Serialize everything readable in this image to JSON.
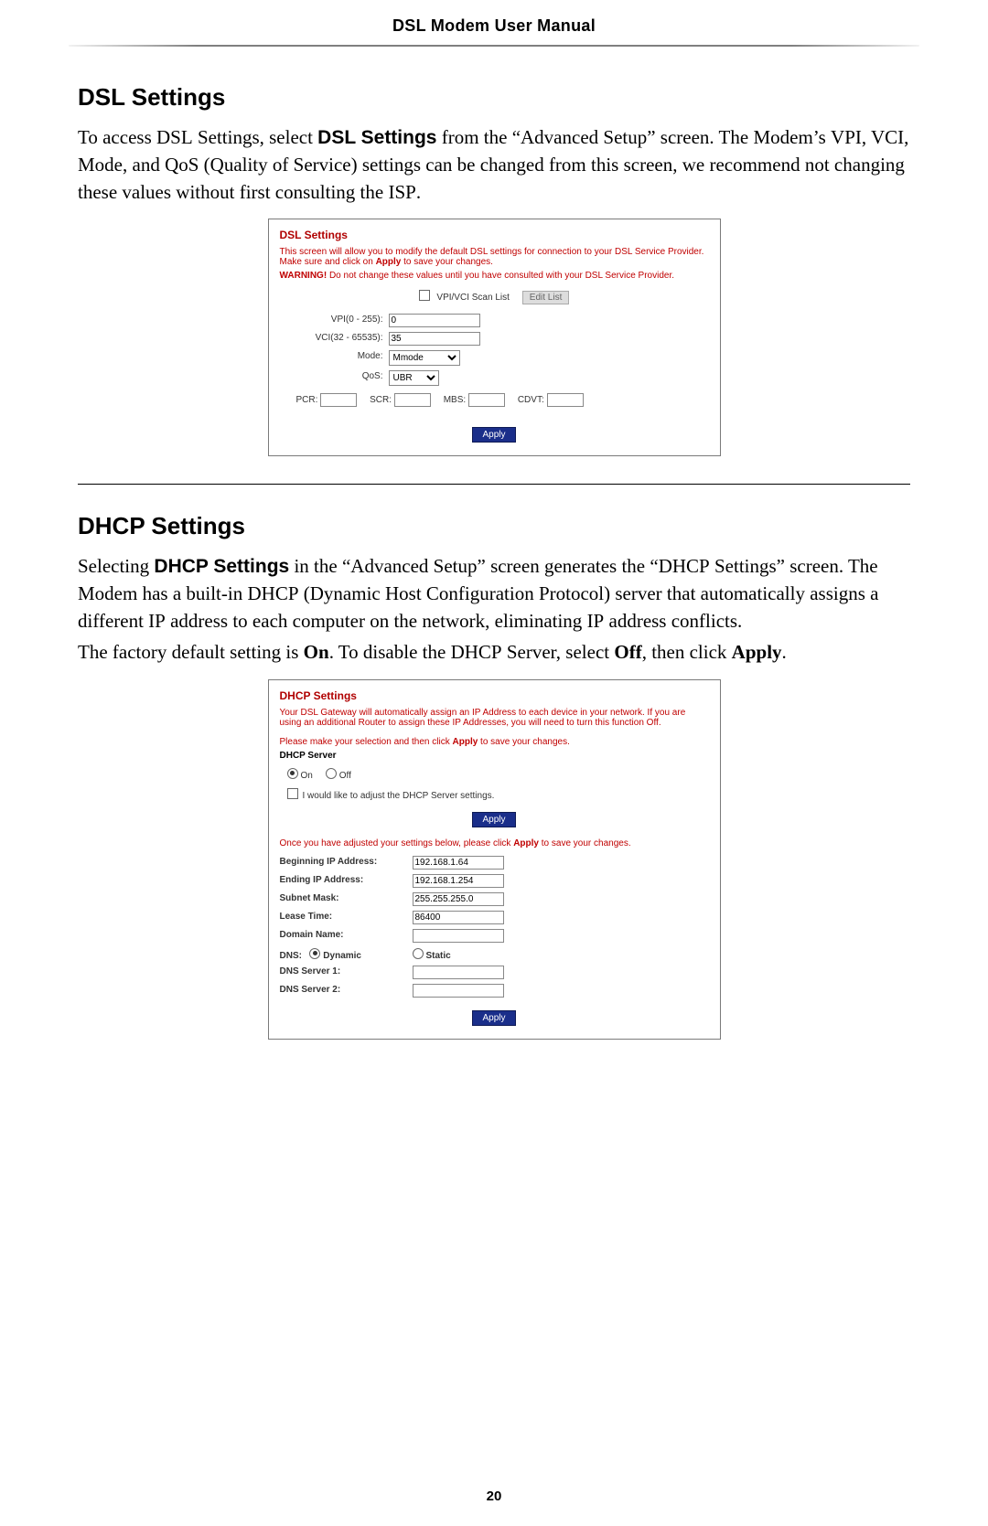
{
  "header": {
    "title": "DSL Modem User Manual"
  },
  "dsl": {
    "heading": "DSL Settings",
    "para1_pre": "To access ",
    "para1_smallcaps1": "DSL",
    "para1_mid1": " Settings, select ",
    "para1_bold_sans": "DSL Settings",
    "para1_mid2": " from the “Advanced Setup” screen. The Modem’s ",
    "para1_smallcaps2": "VPI, VCI",
    "para1_mid3": ", Mode, and QoS (Quality of Service) settings can be changed from this screen, we recommend not changing these values without first consulting the ",
    "para1_smallcaps3": "ISP",
    "para1_end": ".",
    "panel": {
      "title": "DSL Settings",
      "desc1": "This screen will allow you to modify the default DSL settings for connection to your DSL Service Provider. Make sure and click on ",
      "desc1_bold": "Apply",
      "desc1_tail": " to save your changes.",
      "warning_prefix": "WARNING!",
      "warning_text": " Do not change these values until you have consulted with your DSL Service Provider.",
      "scanlist_label": "VPI/VCI Scan List",
      "editlist": "Edit List",
      "vpi_label": "VPI(0 - 255):",
      "vpi_value": "0",
      "vci_label": "VCI(32 - 65535):",
      "vci_value": "35",
      "mode_label": "Mode:",
      "mode_options": [
        "Mmode"
      ],
      "qos_label": "QoS:",
      "qos_options": [
        "UBR"
      ],
      "pcr": "PCR:",
      "scr": "SCR:",
      "mbs": "MBS:",
      "cdvt": "CDVT:",
      "apply": "Apply"
    }
  },
  "dhcp": {
    "heading": "DHCP Settings",
    "p1_a": "Selecting ",
    "p1_bold_sans": "DHCP Settings",
    "p1_b": " in the “Advanced Setup” screen generates the “",
    "p1_sc1": "DHCP",
    "p1_c": " Settings” screen. The Modem has a built-in ",
    "p1_sc2": "DHCP",
    "p1_d": " (Dynamic Host Configuration Protocol) server that automatically assigns a different ",
    "p1_sc3": "IP",
    "p1_e": " address to each computer on the network, eliminating ",
    "p1_sc4": "IP",
    "p1_f": " address conflicts.",
    "p2_a": "The factory default setting is ",
    "p2_bold_on": "On",
    "p2_b": ". To disable the ",
    "p2_sc1": "DHCP",
    "p2_c": " Server, select ",
    "p2_bold_off": "Off",
    "p2_d": ", then click ",
    "p2_bold_apply": "Apply",
    "p2_e": ".",
    "panel": {
      "title": "DHCP Settings",
      "desc1": "Your DSL Gateway will automatically assign an IP Address to each device in your network. If you are using an additional Router to assign these IP Addresses, you will need to turn this function Off.",
      "desc2_a": "Please make your selection and then click ",
      "desc2_bold": "Apply",
      "desc2_b": " to save your changes.",
      "server_label": "DHCP Server",
      "on": "On",
      "off": "Off",
      "adjust_label": "I would like to adjust the DHCP Server settings.",
      "apply": "Apply",
      "note_a": "Once you have adjusted your settings below, please click ",
      "note_bold": "Apply",
      "note_b": " to save your changes.",
      "begin_ip_label": "Beginning IP Address:",
      "begin_ip": "192.168.1.64",
      "end_ip_label": "Ending IP Address:",
      "end_ip": "192.168.1.254",
      "subnet_label": "Subnet Mask:",
      "subnet": "255.255.255.0",
      "lease_label": "Lease Time:",
      "lease": "86400",
      "domain_label": "Domain Name:",
      "domain": "",
      "dns_label": "DNS:",
      "dns_dynamic": "Dynamic",
      "dns_static": "Static",
      "dns1_label": "DNS Server 1:",
      "dns1": "",
      "dns2_label": "DNS Server 2:",
      "dns2": ""
    }
  },
  "page_number": "20"
}
